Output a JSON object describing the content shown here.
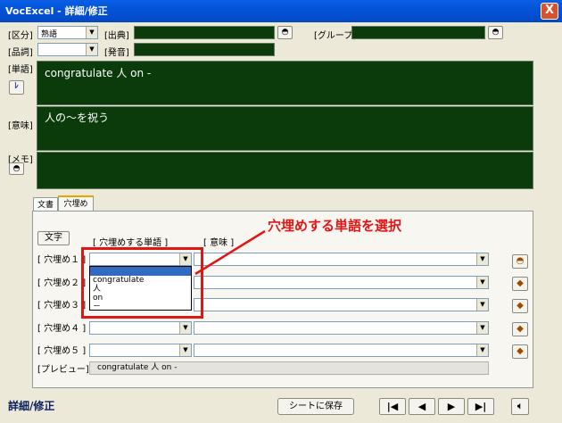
{
  "window": {
    "title": "VocExcel - 詳細/修正",
    "close_label": "X"
  },
  "fields": {
    "kubun_label": "[区分]",
    "kubun_value": "熟語",
    "shutten_label": "[出典]",
    "group_label": "[グループ]",
    "hinshi_label": "[品詞]",
    "hatsuon_label": "[発音]",
    "tango_label": "[単語]",
    "tango_value": "congratulate 人 on -",
    "imi_label": "[意味]",
    "imi_value": "人の～を祝う",
    "memo_label": "[メモ]"
  },
  "tabs": [
    {
      "label": "文書"
    },
    {
      "label": "穴埋め"
    }
  ],
  "cloze": {
    "moji_button": "文字",
    "col_word_header": "[ 穴埋めする単語 ]",
    "col_meaning_header": "[ 意味 ]",
    "rows": [
      {
        "label": "[ 穴埋め１ ]"
      },
      {
        "label": "[ 穴埋め２ ]"
      },
      {
        "label": "[ 穴埋め３ ]"
      },
      {
        "label": "[ 穴埋め４ ]"
      },
      {
        "label": "[ 穴埋め５ ]"
      }
    ],
    "dropdown_options": [
      "congratulate",
      "人",
      "on",
      "－"
    ],
    "preview_label": "[プレビュー]",
    "preview_value": "congratulate 人 on -"
  },
  "annotation": {
    "text": "穴埋めする単語を選択",
    "color": "#e41414"
  },
  "footer": {
    "status": "詳細/修正",
    "save_button": "シートに保存",
    "nav_first": "|◀",
    "nav_prev": "◀",
    "nav_next": "▶",
    "nav_last": "▶|"
  },
  "colors": {
    "green_field": "#0b3b0b",
    "title_bar": "#0454d8",
    "accent_red": "#e41414"
  }
}
